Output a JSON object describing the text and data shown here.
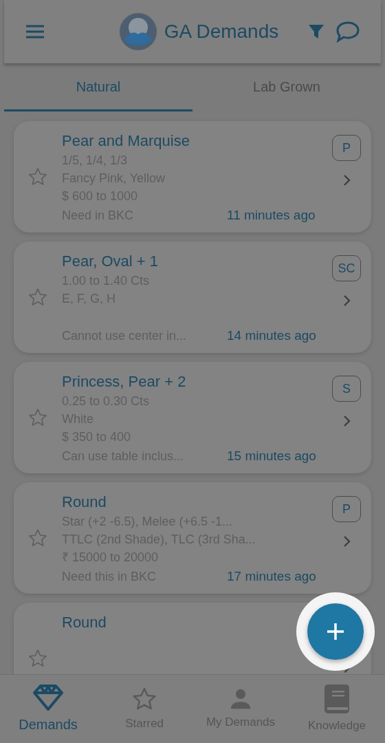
{
  "app_bar": {
    "title": "GA Demands"
  },
  "tabs": [
    {
      "label": "Natural",
      "selected": true
    },
    {
      "label": "Lab Grown",
      "selected": false
    }
  ],
  "demands": [
    {
      "title": "Pear and Marquise",
      "lines": [
        "1/5, 1/4, 1/3",
        "Fancy Pink, Yellow",
        "$ 600 to 1000"
      ],
      "note": "Need in BKC",
      "time": "11 minutes ago",
      "badge": "P",
      "starred": false
    },
    {
      "title": "Pear, Oval + 1",
      "lines": [
        "1.00 to 1.40 Cts",
        "E, F, G, H"
      ],
      "note": "Cannot use center in...",
      "time": "14 minutes ago",
      "badge": "SC",
      "starred": false
    },
    {
      "title": "Princess, Pear + 2",
      "lines": [
        "0.25 to 0.30 Cts",
        "White",
        "$ 350 to 400"
      ],
      "note": "Can use table inclus...",
      "time": "15 minutes ago",
      "badge": "S",
      "starred": false
    },
    {
      "title": "Round",
      "lines": [
        "Star (+2 -6.5), Melee (+6.5 -1...",
        "TTLC (2nd Shade), TLC (3rd Sha...",
        "₹ 15000 to 20000"
      ],
      "note": "Need this in BKC",
      "time": "17 minutes ago",
      "badge": "P",
      "starred": false
    },
    {
      "title": "Round",
      "starred": false
    }
  ],
  "bottom_nav": [
    {
      "label": "Demands",
      "kind": "diamond",
      "selected": true
    },
    {
      "label": "Starred",
      "kind": "star",
      "selected": false
    },
    {
      "label": "My Demands",
      "kind": "person",
      "selected": false
    },
    {
      "label": "Knowledge",
      "kind": "book",
      "selected": false
    }
  ]
}
